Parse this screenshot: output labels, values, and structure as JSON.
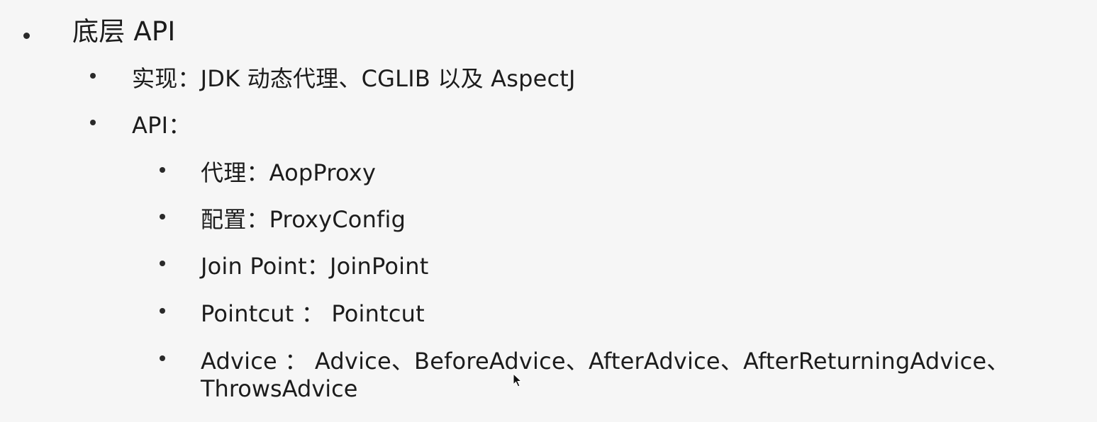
{
  "items": [
    {
      "level": 1,
      "text": "底层 API"
    },
    {
      "level": 2,
      "text": "实现：JDK 动态代理、CGLIB 以及 AspectJ"
    },
    {
      "level": 2,
      "text": "API："
    },
    {
      "level": 3,
      "text": "代理：AopProxy"
    },
    {
      "level": 3,
      "text": "配置：ProxyConfig"
    },
    {
      "level": 3,
      "text": "Join Point：JoinPoint"
    },
    {
      "level": 3,
      "text": "Pointcut ： Pointcut"
    },
    {
      "level": 3,
      "text": "Advice ： Advice、BeforeAdvice、AfterAdvice、AfterReturningAdvice、",
      "continuation": "ThrowsAdvice"
    }
  ]
}
